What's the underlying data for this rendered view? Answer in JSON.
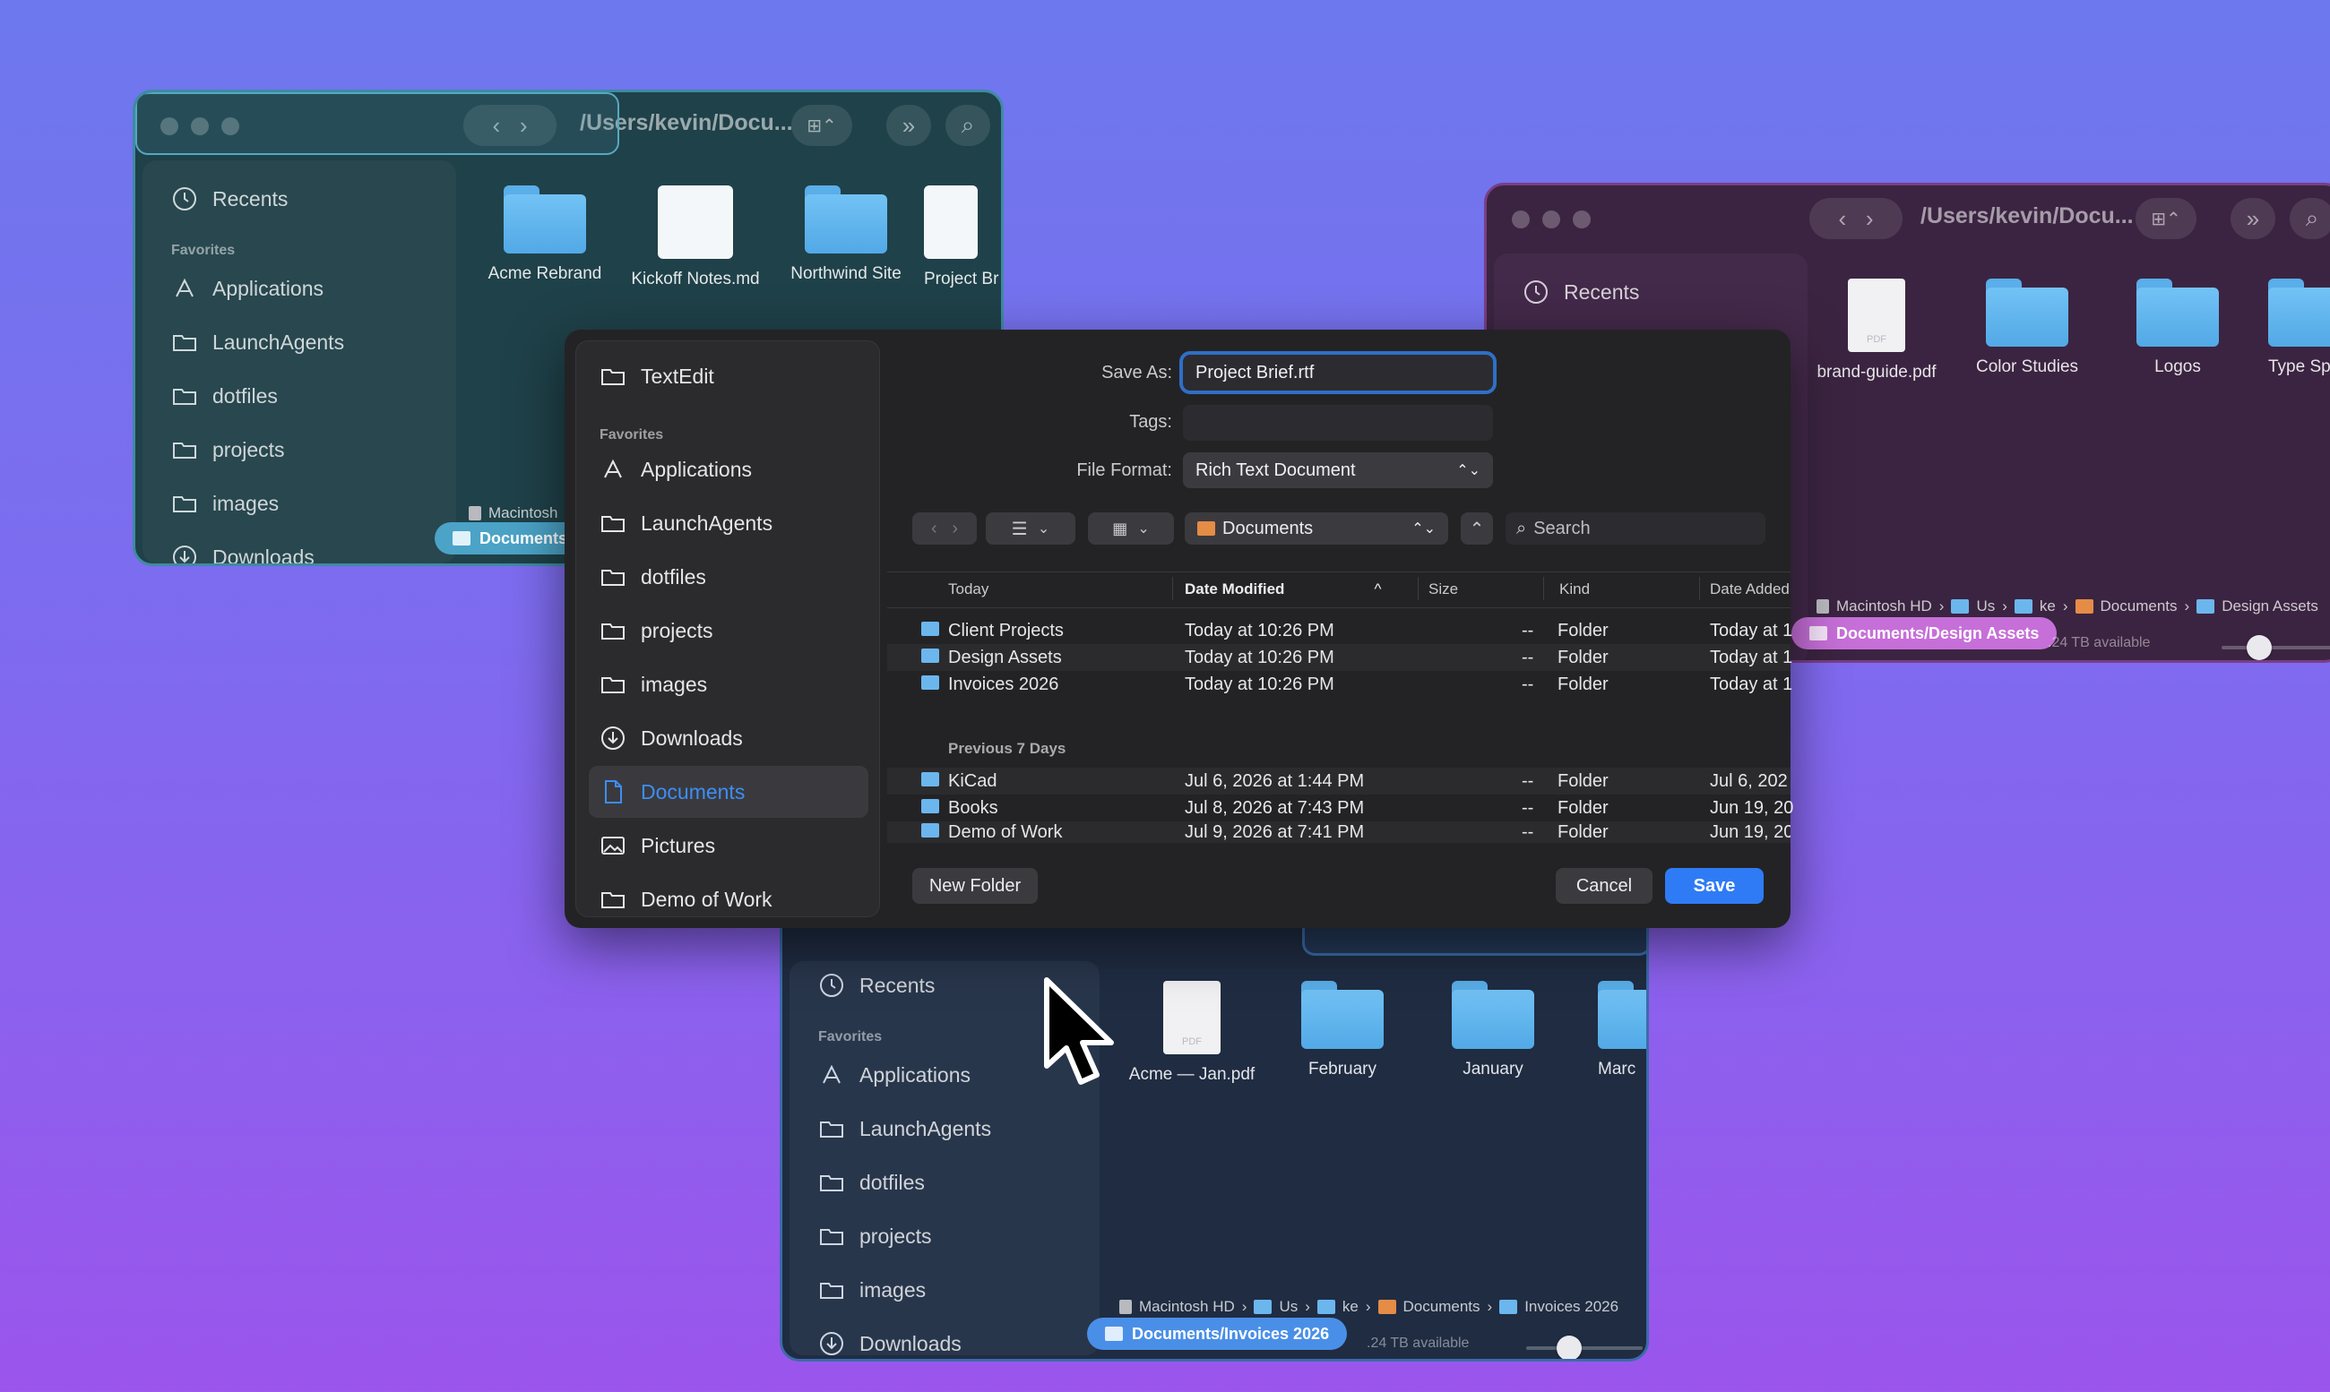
{
  "colors": {
    "accent": "#2f7bf6",
    "folder": "#5aaee9",
    "teal_pill": "#4ba3c7",
    "purple_pill": "#c66fd8",
    "blue_pill": "#4a8fe7"
  },
  "win_teal": {
    "path_title": "/Users/kevin/Docu...",
    "sidebar": {
      "recents": "Recents",
      "favorites_head": "Favorites",
      "items": [
        "Applications",
        "LaunchAgents",
        "dotfiles",
        "projects",
        "images",
        "Downloads"
      ]
    },
    "grid": [
      "Acme Rebrand",
      "Kickoff Notes.md",
      "Northwind Site",
      "Project Br"
    ],
    "pathbar_disk": "Macintosh",
    "pill": "Documents/"
  },
  "win_purple": {
    "path_title": "/Users/kevin/Docu...",
    "sidebar": {
      "recents": "Recents"
    },
    "grid": [
      "brand-guide.pdf",
      "Color Studies",
      "Logos",
      "Type Sp"
    ],
    "pdf_label": "PDF",
    "pathbar": [
      "Macintosh HD",
      "Us",
      "ke",
      "Documents",
      "Design Assets"
    ],
    "pill": "Documents/Design Assets",
    "available": ".24 TB available"
  },
  "win_blue": {
    "sidebar": {
      "recents": "Recents",
      "favorites_head": "Favorites",
      "items": [
        "Applications",
        "LaunchAgents",
        "dotfiles",
        "projects",
        "images",
        "Downloads"
      ]
    },
    "grid": [
      "Acme — Jan.pdf",
      "February",
      "January",
      "Marc"
    ],
    "pdf_label": "PDF",
    "pathbar": [
      "Macintosh HD",
      "Us",
      "ke",
      "Documents",
      "Invoices 2026"
    ],
    "pill": "Documents/Invoices 2026",
    "available": ".24 TB available"
  },
  "dialog": {
    "sidebar": {
      "app": "TextEdit",
      "favorites_head": "Favorites",
      "items": [
        "Applications",
        "LaunchAgents",
        "dotfiles",
        "projects",
        "images",
        "Downloads",
        "Documents",
        "Pictures",
        "Demo of Work"
      ],
      "active": "Documents"
    },
    "save_as_label": "Save As:",
    "save_as_value": "Project Brief.rtf",
    "tags_label": "Tags:",
    "tags_value": "",
    "format_label": "File Format:",
    "format_value": "Rich Text Document",
    "location": "Documents",
    "search_placeholder": "Search",
    "columns": {
      "name": "Today",
      "date": "Date Modified",
      "size": "Size",
      "kind": "Kind",
      "added": "Date Added"
    },
    "group_today": [
      {
        "name": "Client Projects",
        "date": "Today at 10:26 PM",
        "size": "--",
        "kind": "Folder",
        "added": "Today at 1"
      },
      {
        "name": "Design Assets",
        "date": "Today at 10:26 PM",
        "size": "--",
        "kind": "Folder",
        "added": "Today at 1"
      },
      {
        "name": "Invoices 2026",
        "date": "Today at 10:26 PM",
        "size": "--",
        "kind": "Folder",
        "added": "Today at 1"
      }
    ],
    "group_prev_label": "Previous 7 Days",
    "group_prev": [
      {
        "name": "KiCad",
        "date": "Jul 6, 2026 at 1:44 PM",
        "size": "--",
        "kind": "Folder",
        "added": "Jul 6, 202"
      },
      {
        "name": "Books",
        "date": "Jul 8, 2026 at 7:43 PM",
        "size": "--",
        "kind": "Folder",
        "added": "Jun 19, 20"
      },
      {
        "name": "Demo of Work",
        "date": "Jul 9, 2026 at 7:41 PM",
        "size": "--",
        "kind": "Folder",
        "added": "Jun 19, 20"
      }
    ],
    "new_folder": "New Folder",
    "cancel": "Cancel",
    "save": "Save"
  }
}
